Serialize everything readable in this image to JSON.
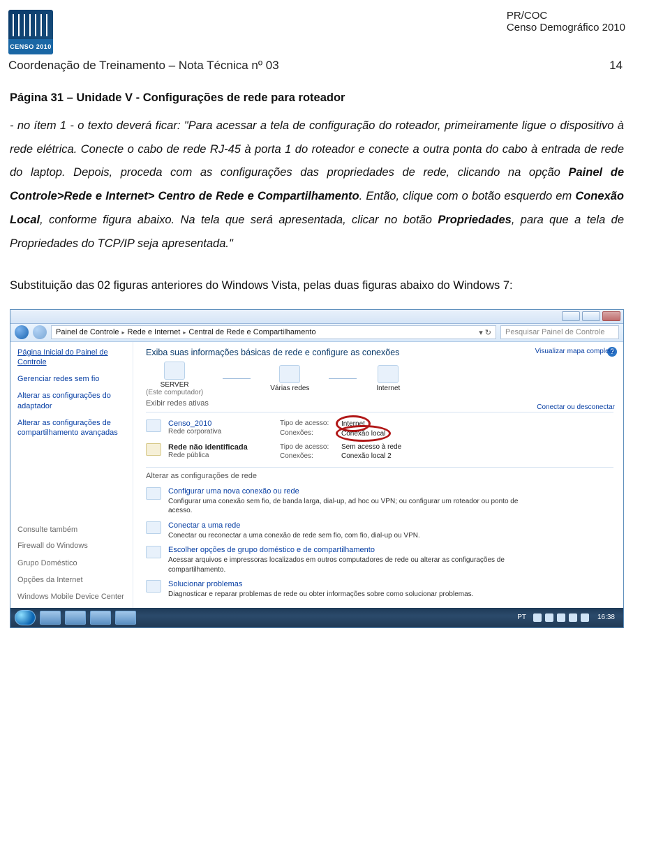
{
  "header_right": {
    "line1": "PR/COC",
    "line2": "Censo Demográfico 2010"
  },
  "coord": "Coordenação de Treinamento – Nota Técnica nº 03",
  "page_number": "14",
  "logo_label": "CENSO 2010",
  "title": "Página 31 – Unidade V - Configurações de rede para roteador",
  "body_pre": "- no ítem 1 - o texto deverá ficar: \"Para acessar a tela de configuração do roteador, primeiramente ligue o dispositivo à rede elétrica. Conecte o cabo de rede RJ-45 à porta 1 do roteador e conecte a outra ponta do cabo à entrada de rede do laptop. Depois, proceda com as configurações das propriedades de rede, clicando na opção ",
  "body_bold1": "Painel de Controle>Rede e Internet> Centro de Rede e Compartilhamento",
  "body_mid1": ". Então, clique com o botão esquerdo em ",
  "body_bold2": "Conexão Local",
  "body_mid2": ", conforme figura abaixo. Na tela que será apresentada, clicar no botão ",
  "body_bold3": "Propriedades",
  "body_post": ", para que a tela de Propriedades do TCP/IP seja apresentada.\"",
  "subst": "Substituição das 02 figuras anteriores do Windows Vista, pelas duas figuras abaixo do Windows 7:",
  "win": {
    "crumb": [
      "Painel de Controle",
      "Rede e Internet",
      "Central de Rede e Compartilhamento"
    ],
    "search_ph": "Pesquisar Painel de Controle",
    "sidebar": [
      "Página Inicial do Painel de Controle",
      "Gerenciar redes sem fio",
      "Alterar as configurações do adaptador",
      "Alterar as configurações de compartilhamento avançadas"
    ],
    "sidebar_footer": [
      "Consulte também",
      "Firewall do Windows",
      "Grupo Doméstico",
      "Opções da Internet",
      "Windows Mobile Device Center"
    ],
    "heading": "Exiba suas informações básicas de rede e configure as conexões",
    "topmap": {
      "server": "SERVER",
      "server_sub": "(Este computador)",
      "multi": "Várias redes",
      "internet": "Internet"
    },
    "view_full": "Visualizar mapa completo",
    "exibir": "Exibir redes ativas",
    "conn_dis": "Conectar ou desconectar",
    "net1": {
      "name": "Censo_2010",
      "type": "Rede corporativa",
      "k1": "Tipo de acesso:",
      "v1": "Internet",
      "k2": "Conexões:",
      "v2": "Conexão local"
    },
    "net2": {
      "name": "Rede não identificada",
      "type": "Rede pública",
      "k1": "Tipo de acesso:",
      "v1": "Sem acesso à rede",
      "k2": "Conexões:",
      "v2": "Conexão local 2"
    },
    "alterar": "Alterar as configurações de rede",
    "tasks": [
      {
        "t": "Configurar uma nova conexão ou rede",
        "d": "Configurar uma conexão sem fio, de banda larga, dial-up, ad hoc ou VPN; ou configurar um roteador ou ponto de acesso."
      },
      {
        "t": "Conectar a uma rede",
        "d": "Conectar ou reconectar a uma conexão de rede sem fio, com fio, dial-up ou VPN."
      },
      {
        "t": "Escolher opções de grupo doméstico e de compartilhamento",
        "d": "Acessar arquivos e impressoras localizados em outros computadores de rede ou alterar as configurações de compartilhamento."
      },
      {
        "t": "Solucionar problemas",
        "d": "Diagnosticar e reparar problemas de rede ou obter informações sobre como solucionar problemas."
      }
    ],
    "lang": "PT",
    "clock": "16:38"
  }
}
